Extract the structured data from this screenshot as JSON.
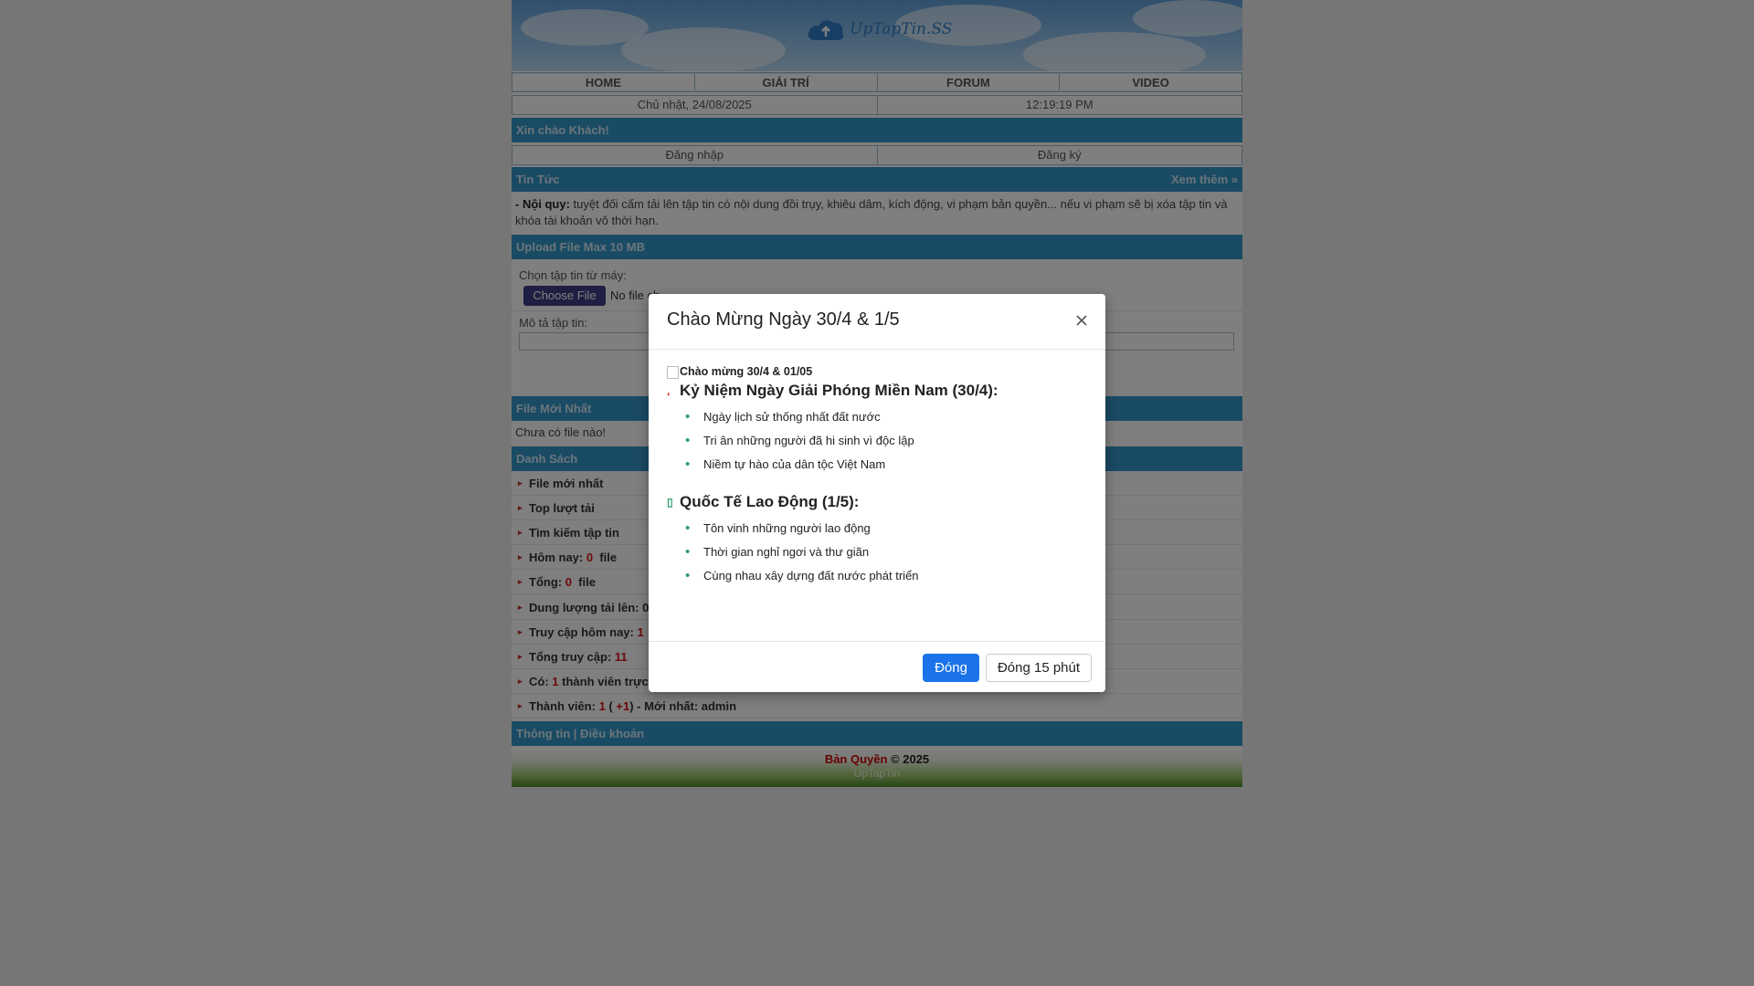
{
  "header": {
    "logo_text": "UpTapTin.SS"
  },
  "menu": [
    "HOME",
    "GIẢI TRÍ",
    "FORUM",
    "VIDEO"
  ],
  "info": {
    "date": "Chủ nhật, 24/08/2025",
    "time": "12:19:19 PM"
  },
  "greeting": "Xin chào Khách!",
  "auth": {
    "login": "Đăng nhập",
    "register": "Đăng ký"
  },
  "news": {
    "title": "Tin Tức",
    "more": "Xem thêm"
  },
  "notice": {
    "label": "- Nội quy:",
    "text": " tuyệt đối cấm tải lên tập tin có nội dung đồi trụy, khiêu dâm, kích động, vi phạm bản quyền... nếu vi phạm sẽ bị xóa tập tin và khóa tài khoản vô thời hạn."
  },
  "upload": {
    "title": "Upload File Max 10 MB",
    "choose_label": "Chọn tập tin từ máy:",
    "choose_button": "Choose File",
    "no_file": "No file ch",
    "desc_label": "Mô tả tập tin:"
  },
  "latest": {
    "title": "File Mới Nhất",
    "empty": "Chưa có file nào!"
  },
  "list": {
    "title": "Danh Sách",
    "items": {
      "newest": "File mới nhất",
      "top": "Top lượt tải",
      "search": "Tìm kiếm tập tin",
      "today_label": "Hôm nay: ",
      "today_value": "0",
      "today_unit": "  file",
      "total_label": "Tổng: ",
      "total_value": "0",
      "total_unit": "  file",
      "capacity": "Dung lượng tải lên: 0",
      "access_today_label": "Truy cập hôm nay: ",
      "access_today_value": "1",
      "access_total_label": "Tổng truy cập: ",
      "access_total_value": "11",
      "online_label": "Có: ",
      "online_value": "1",
      "online_unit": " thành viên trực",
      "members_label": "Thành viên: ",
      "members_value": "1",
      "members_open": " ( ",
      "members_new": "+1",
      "members_close": ") - ",
      "members_latest": "Mới nhất: admin"
    }
  },
  "footer_links": "Thông tin | Điều khoản",
  "footer": {
    "copyright_red": "Bản Quyền",
    "copyright_rest": " © 2025",
    "sub": "UpTapTin"
  },
  "modal": {
    "title": "Chào Mừng Ngày 30/4 & 1/5",
    "image_alt": "Chào mừng 30/4 & 01/05",
    "section1": {
      "heading": "Kỷ Niệm Ngày Giải Phóng Miền Nam (30/4):",
      "items": [
        "Ngày lịch sử thống nhất đất nước",
        "Tri ân những người đã hi sinh vì độc lập",
        "Niềm tự hào của dân tộc Việt Nam"
      ]
    },
    "section2": {
      "heading": "Quốc Tế Lao Động (1/5):",
      "items": [
        "Tôn vinh những người lao động",
        "Thời gian nghỉ ngơi và thư giãn",
        "Cùng nhau xây dựng đất nước phát triển"
      ]
    },
    "close_button": "Đóng",
    "close15_button": "Đóng 15 phút"
  },
  "colors": {
    "section_bar": "#3596c8",
    "accent_red": "#d11",
    "primary_button": "#1a73e8",
    "bullet": "#2e9e6a"
  }
}
